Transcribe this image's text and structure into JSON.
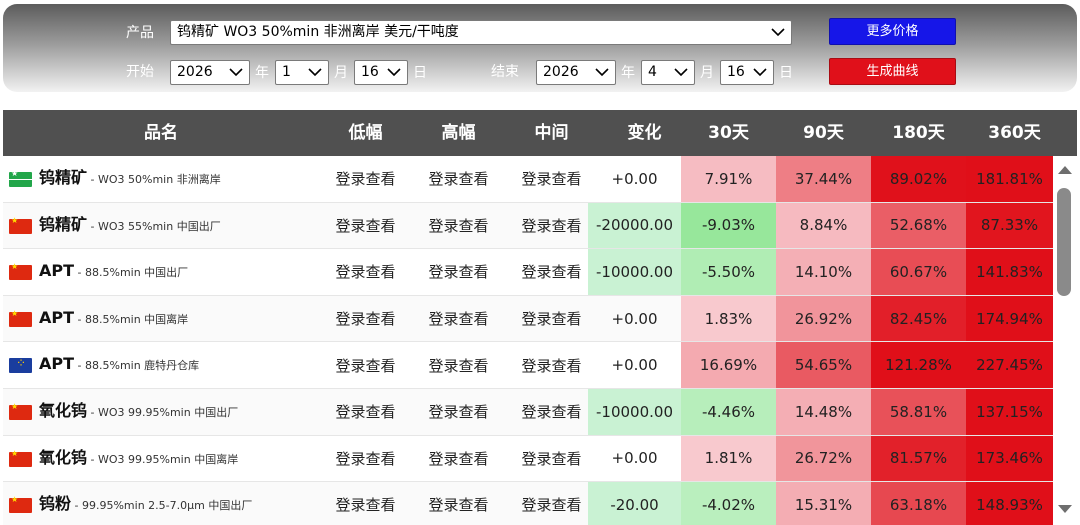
{
  "filters": {
    "product_label": "产品",
    "product_value": "钨精矿 WO3 50%min 非洲离岸 美元/干吨度",
    "start_label": "开始",
    "start_year": "2026",
    "start_month": "1",
    "start_day": "16",
    "end_label": "结束",
    "end_year": "2026",
    "end_month": "4",
    "end_day": "16",
    "year_unit": "年",
    "month_unit": "月",
    "day_unit": "日",
    "more_prices_button": "更多价格",
    "generate_curve_button": "生成曲线",
    "more_prices_color": "#1616e8",
    "generate_curve_color": "#e0101a"
  },
  "table": {
    "headers": [
      "品名",
      "低幅",
      "高幅",
      "中间",
      "变化",
      "30天",
      "90天",
      "180天",
      "360天"
    ],
    "rows": [
      {
        "flag": "african-flag",
        "name": "钨精矿",
        "spec": "WO3 50%min 非洲离岸",
        "low": "登录查看",
        "high": "登录查看",
        "mid": "登录查看",
        "change": "+0.00",
        "d30": "7.91%",
        "d90": "37.44%",
        "d180": "89.02%",
        "d360": "181.81%"
      },
      {
        "flag": "china-flag",
        "name": "钨精矿",
        "spec": "WO3 55%min 中国出厂",
        "low": "登录查看",
        "high": "登录查看",
        "mid": "登录查看",
        "change": "-20000.00",
        "d30": "-9.03%",
        "d90": "8.84%",
        "d180": "52.68%",
        "d360": "87.33%"
      },
      {
        "flag": "china-flag",
        "name": "APT",
        "spec": "88.5%min 中国出厂",
        "low": "登录查看",
        "high": "登录查看",
        "mid": "登录查看",
        "change": "-10000.00",
        "d30": "-5.50%",
        "d90": "14.10%",
        "d180": "60.67%",
        "d360": "141.83%"
      },
      {
        "flag": "china-flag",
        "name": "APT",
        "spec": "88.5%min 中国离岸",
        "low": "登录查看",
        "high": "登录查看",
        "mid": "登录查看",
        "change": "+0.00",
        "d30": "1.83%",
        "d90": "26.92%",
        "d180": "82.45%",
        "d360": "174.94%"
      },
      {
        "flag": "eu-flag",
        "name": "APT",
        "spec": "88.5%min 鹿特丹仓库",
        "low": "登录查看",
        "high": "登录查看",
        "mid": "登录查看",
        "change": "+0.00",
        "d30": "16.69%",
        "d90": "54.65%",
        "d180": "121.28%",
        "d360": "227.45%"
      },
      {
        "flag": "china-flag",
        "name": "氧化钨",
        "spec": "WO3 99.95%min 中国出厂",
        "low": "登录查看",
        "high": "登录查看",
        "mid": "登录查看",
        "change": "-10000.00",
        "d30": "-4.46%",
        "d90": "14.48%",
        "d180": "58.81%",
        "d360": "137.15%"
      },
      {
        "flag": "china-flag",
        "name": "氧化钨",
        "spec": "WO3 99.95%min 中国离岸",
        "low": "登录查看",
        "high": "登录查看",
        "mid": "登录查看",
        "change": "+0.00",
        "d30": "1.81%",
        "d90": "26.72%",
        "d180": "81.57%",
        "d360": "173.46%"
      },
      {
        "flag": "china-flag",
        "name": "钨粉",
        "spec": "99.95%min 2.5-7.0μm 中国出厂",
        "low": "登录查看",
        "high": "登录查看",
        "mid": "登录查看",
        "change": "-20.00",
        "d30": "-4.02%",
        "d90": "15.31%",
        "d180": "63.18%",
        "d360": "148.93%"
      }
    ]
  }
}
